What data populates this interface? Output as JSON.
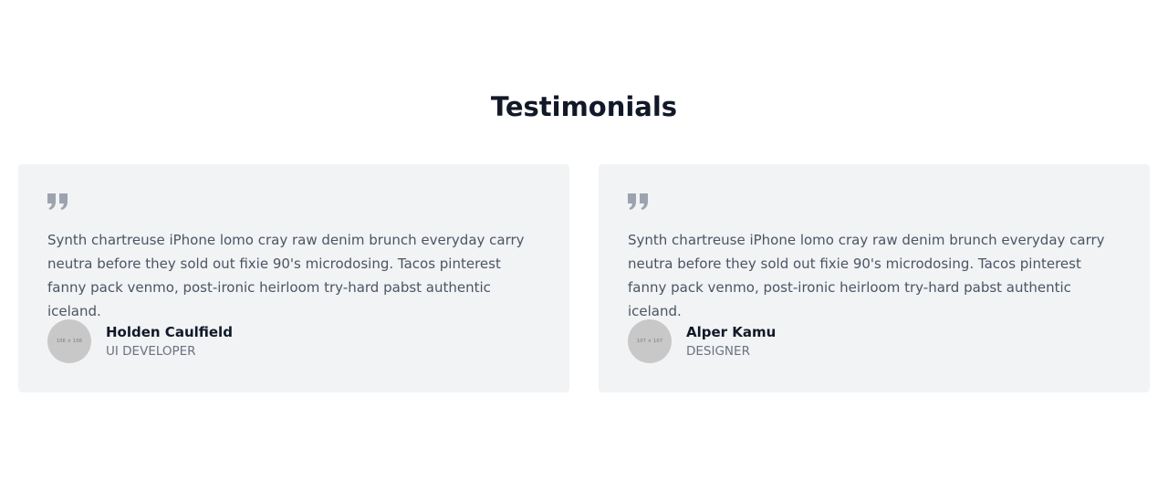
{
  "section": {
    "title": "Testimonials"
  },
  "testimonials": [
    {
      "quote": "Synth chartreuse iPhone lomo cray raw denim brunch everyday carry neutra before they sold out fixie 90's microdosing. Tacos pinterest fanny pack venmo, post-ironic heirloom try-hard pabst authentic iceland.",
      "avatar_placeholder": "106 × 106",
      "name": "Holden Caulfield",
      "role": "UI DEVELOPER"
    },
    {
      "quote": "Synth chartreuse iPhone lomo cray raw denim brunch everyday carry neutra before they sold out fixie 90's microdosing. Tacos pinterest fanny pack venmo, post-ironic heirloom try-hard pabst authentic iceland.",
      "avatar_placeholder": "107 × 107",
      "name": "Alper Kamu",
      "role": "DESIGNER"
    }
  ],
  "icons": {
    "quote": "quote-icon"
  },
  "colors": {
    "card_background": "#f1f3f5",
    "title": "#111827",
    "body_text": "#4b5563",
    "quote_icon": "#9ca3af",
    "avatar": "#c8c8c8"
  }
}
